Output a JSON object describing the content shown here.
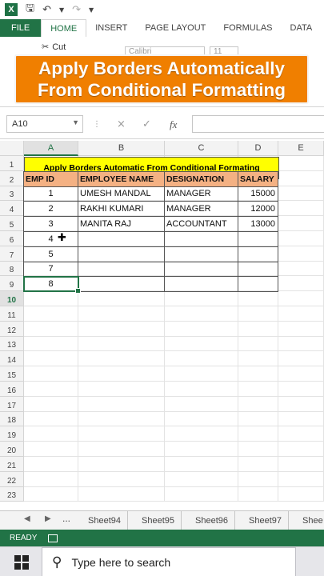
{
  "titlebar": {
    "app_icon": "X",
    "icons": [
      "save-icon",
      "undo-icon",
      "redo-icon"
    ]
  },
  "tabs": [
    "FILE",
    "HOME",
    "INSERT",
    "PAGE LAYOUT",
    "FORMULAS",
    "DATA"
  ],
  "ribbon": {
    "cut_label": "Cut",
    "font_name": "Calibri",
    "font_size": "11"
  },
  "caption": {
    "line1": "Apply Borders Automatically",
    "line2": "From Conditional Formatting"
  },
  "formula_bar": {
    "name_box": "A10",
    "cancel_icon": "×",
    "enter_icon": "✓",
    "fx_label": "fx",
    "value": ""
  },
  "columns": [
    "A",
    "B",
    "C",
    "D",
    "E"
  ],
  "rows": [
    "1",
    "2",
    "3",
    "4",
    "5",
    "6",
    "7",
    "8",
    "9",
    "10",
    "11",
    "12",
    "13",
    "14",
    "15",
    "16",
    "17",
    "18",
    "19",
    "20",
    "21",
    "22",
    "23"
  ],
  "table": {
    "title": "Apply Borders Automatic From Conditional Formating",
    "headers": [
      "EMP ID",
      "EMPLOYEE NAME",
      "DESIGNATION",
      "SALARY"
    ],
    "rows": [
      [
        "1",
        "UMESH MANDAL",
        "MANAGER",
        "15000"
      ],
      [
        "2",
        "RAKHI KUMARI",
        "MANAGER",
        "12000"
      ],
      [
        "3",
        "MANITA RAJ",
        "ACCOUNTANT",
        "13000"
      ],
      [
        "4",
        "",
        "",
        ""
      ],
      [
        "5",
        "",
        "",
        ""
      ],
      [
        "7",
        "",
        "",
        ""
      ],
      [
        "8",
        "",
        "",
        ""
      ]
    ]
  },
  "sheets": {
    "ellipsis": "...",
    "names": [
      "Sheet94",
      "Sheet95",
      "Sheet96",
      "Sheet97",
      "Shee"
    ]
  },
  "status": {
    "text": "READY"
  },
  "taskbar": {
    "search_placeholder": "Type here to search"
  }
}
